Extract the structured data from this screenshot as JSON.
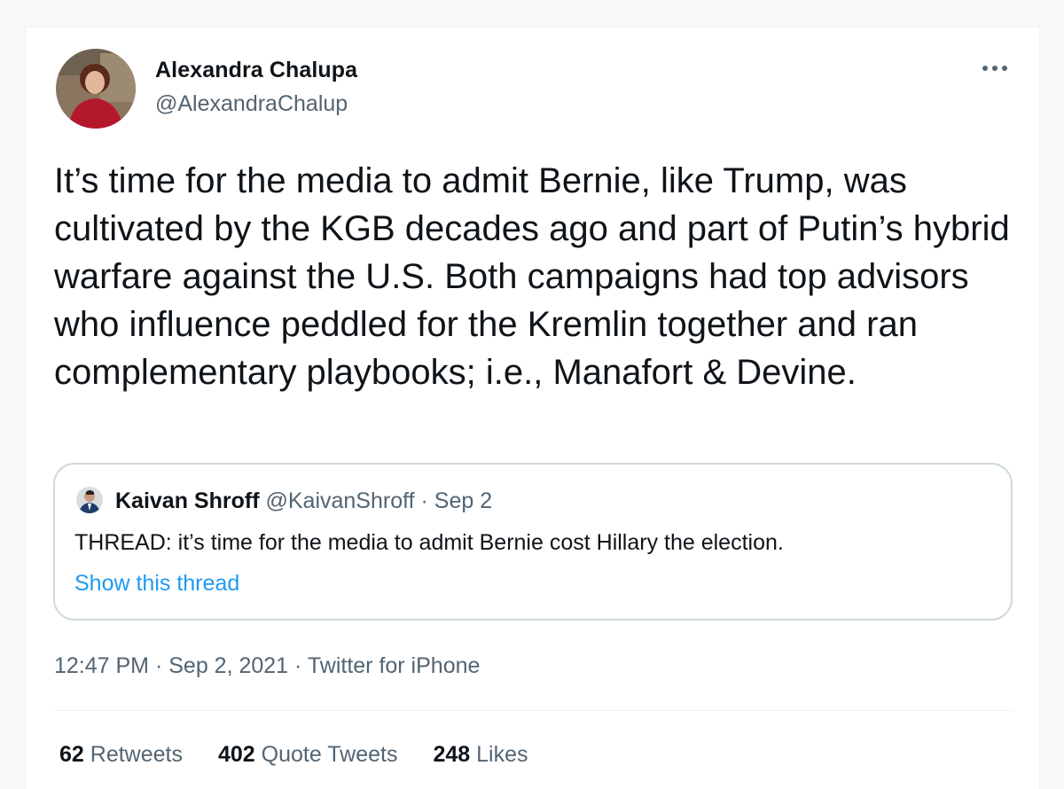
{
  "tweet": {
    "author": {
      "display_name": "Alexandra Chalupa",
      "handle": "@AlexandraChalup"
    },
    "text": "It’s time for the media to admit Bernie, like Trump, was cultivated by the KGB decades ago and part of Putin’s hybrid warfare against the U.S. Both campaigns had top advisors who influence peddled for the Kremlin together and ran complementary playbooks; i.e., Manafort & Devine.",
    "quoted": {
      "display_name": "Kaivan Shroff",
      "handle": "@KaivanShroff",
      "separator": "·",
      "date": "Sep 2",
      "text": "THREAD: it’s time for the media to admit Bernie cost Hillary the election.",
      "show_thread_label": "Show this thread"
    },
    "time": "12:47 PM",
    "date": "Sep 2, 2021",
    "source": "Twitter for iPhone",
    "separator": "·"
  },
  "stats": {
    "retweets": {
      "count": "62",
      "label": "Retweets"
    },
    "quote_tweets": {
      "count": "402",
      "label": "Quote Tweets"
    },
    "likes": {
      "count": "248",
      "label": "Likes"
    }
  },
  "icons": {
    "more": "more-horizontal-icon"
  },
  "colors": {
    "link": "#1d9bf0",
    "secondary_text": "#536471",
    "primary_text": "#0f1419",
    "border": "#cfd9de"
  }
}
